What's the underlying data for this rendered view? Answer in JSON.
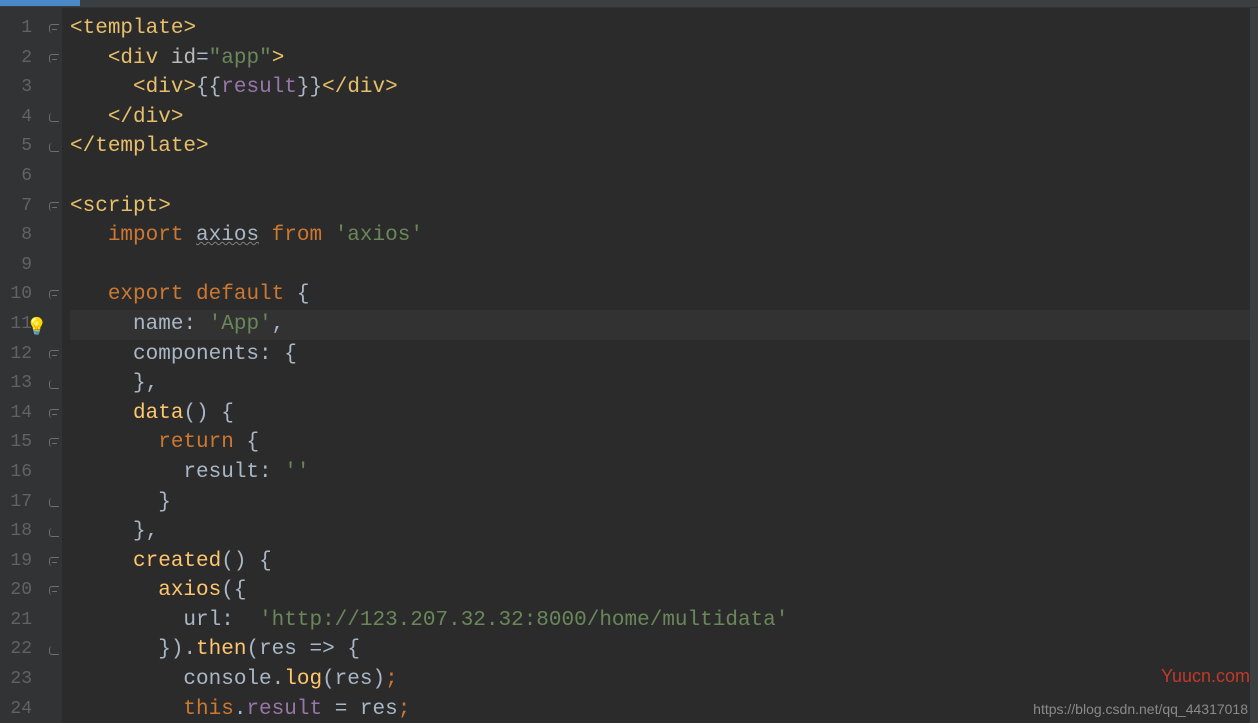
{
  "lines": [
    "1",
    "2",
    "3",
    "4",
    "5",
    "6",
    "7",
    "8",
    "9",
    "10",
    "11",
    "12",
    "13",
    "14",
    "15",
    "16",
    "17",
    "18",
    "19",
    "20",
    "21",
    "22",
    "23",
    "24"
  ],
  "code": {
    "l1": {
      "open": "<",
      "tag": "template",
      "close": ">"
    },
    "l2": {
      "open": "<",
      "tag": "div",
      "sp": " ",
      "attr": "id",
      "eq": "=",
      "q": "\"",
      "val": "app",
      "close": ">"
    },
    "l3": {
      "open": "<",
      "tag": "div",
      "close": ">",
      "mo": "{{",
      "ident": "result",
      "mc": "}}",
      "open2": "</",
      "close2": ">"
    },
    "l4": {
      "open": "</",
      "tag": "div",
      "close": ">"
    },
    "l5": {
      "open": "</",
      "tag": "template",
      "close": ">"
    },
    "l7": {
      "open": "<",
      "tag": "script",
      "close": ">"
    },
    "l8": {
      "kw1": "import",
      "sp": " ",
      "ident": "axios",
      "sp2": " ",
      "kw2": "from",
      "sp3": " ",
      "str": "'axios'"
    },
    "l10": {
      "kw1": "export",
      "sp": " ",
      "kw2": "default",
      "sp2": " ",
      "brace": "{"
    },
    "l11": {
      "key": "name",
      "colon": ":",
      "sp": " ",
      "str": "'App'",
      "comma": ","
    },
    "l12": {
      "key": "components",
      "colon": ":",
      "sp": " ",
      "brace": "{"
    },
    "l13": {
      "brace": "}",
      "comma": ","
    },
    "l14": {
      "fn": "data",
      "paren": "()",
      "sp": " ",
      "brace": "{"
    },
    "l15": {
      "kw": "return",
      "sp": " ",
      "brace": "{"
    },
    "l16": {
      "key": "result",
      "colon": ":",
      "sp": " ",
      "str": "''"
    },
    "l17": {
      "brace": "}"
    },
    "l18": {
      "brace": "}",
      "comma": ","
    },
    "l19": {
      "fn": "created",
      "paren": "()",
      "sp": " ",
      "brace": "{"
    },
    "l20": {
      "fn": "axios",
      "paren": "(",
      "brace": "{"
    },
    "l21": {
      "key": "url",
      "colon": ":",
      "sp": "  ",
      "str": "'http://123.207.32.32:8000/home/multidata'"
    },
    "l22": {
      "brace": "}",
      "paren": ")",
      "dot": ".",
      "fn": "then",
      "paren2": "(",
      "arg": "res",
      "sp": " ",
      "arrow": "=>",
      "sp2": " ",
      "brace2": "{"
    },
    "l23": {
      "obj": "console",
      "dot": ".",
      "fn": "log",
      "paren": "(",
      "arg": "res",
      "paren2": ")",
      "semi": ";"
    },
    "l24": {
      "this": "this",
      "dot": ".",
      "prop": "result",
      "sp": " ",
      "eq": "=",
      "sp2": " ",
      "arg": "res",
      "semi": ";"
    }
  },
  "bulb": "💡",
  "watermark": "Yuucn.com",
  "footer": "https://blog.csdn.net/qq_44317018"
}
